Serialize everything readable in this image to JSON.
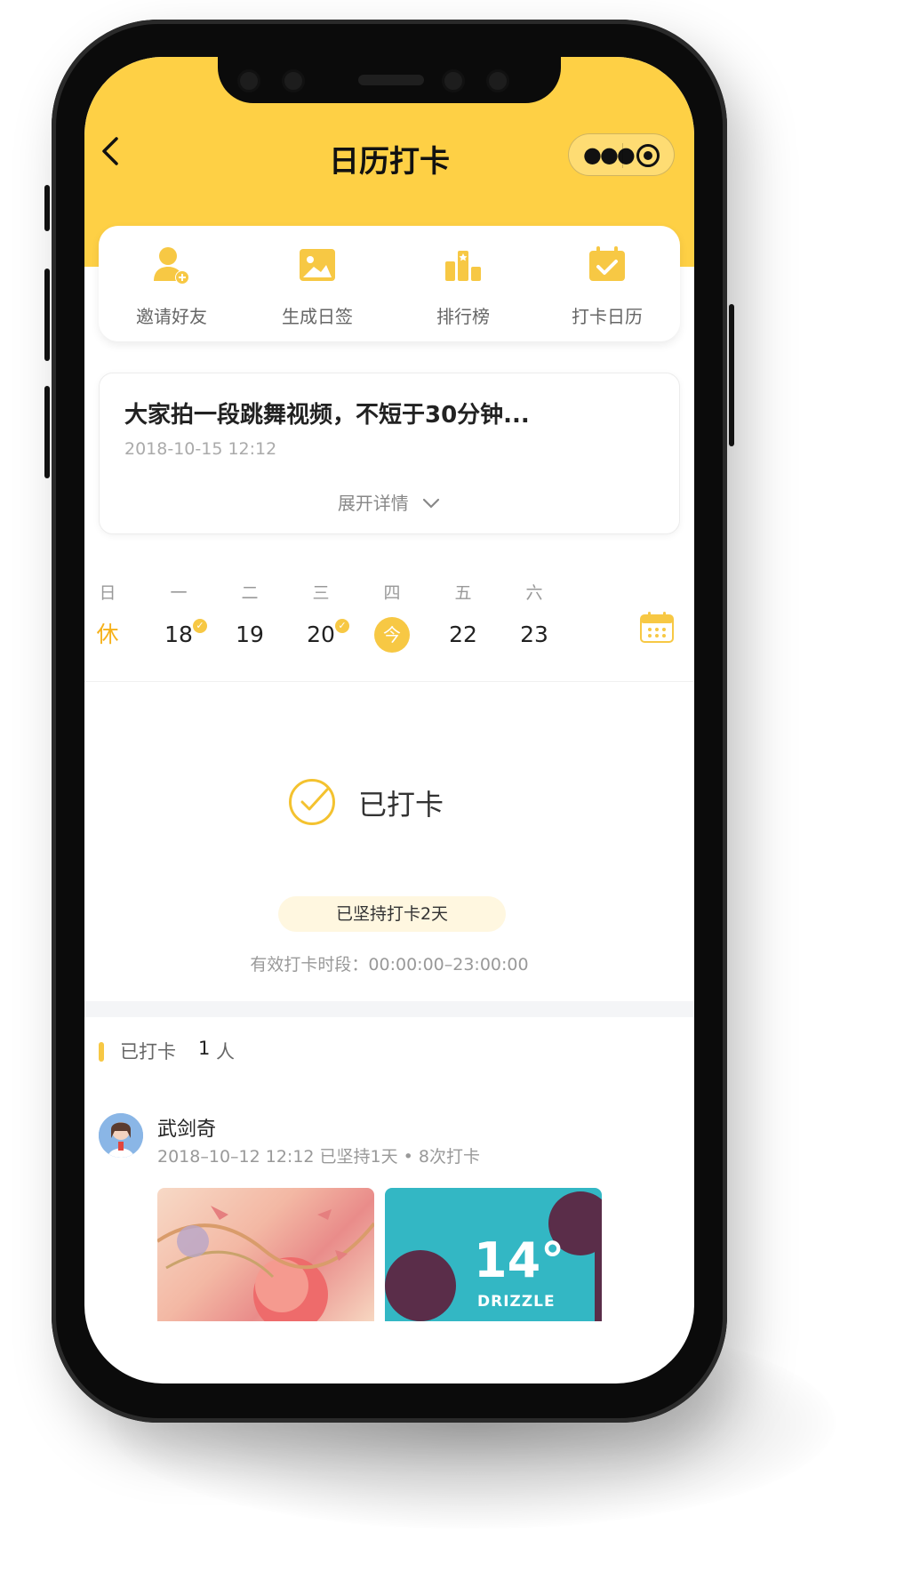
{
  "header": {
    "title": "日历打卡",
    "back_icon": "chevron-left-icon",
    "more_icon": "more-dots-icon",
    "close_icon": "record-circle-icon"
  },
  "quick_actions": [
    {
      "label": "邀请好友",
      "icon": "add-user-icon"
    },
    {
      "label": "生成日签",
      "icon": "image-icon"
    },
    {
      "label": "排行榜",
      "icon": "ranking-icon"
    },
    {
      "label": "打卡日历",
      "icon": "calendar-check-icon"
    }
  ],
  "topic": {
    "title": "大家拍一段跳舞视频，不短于30分钟...",
    "date": "2018-10-15 12:12",
    "expand_label": "展开详情"
  },
  "week": {
    "weekdays": [
      "日",
      "一",
      "二",
      "三",
      "四",
      "五",
      "六"
    ],
    "days": [
      {
        "label": "休",
        "state": "rest"
      },
      {
        "label": "18",
        "state": "checked"
      },
      {
        "label": "19",
        "state": "normal"
      },
      {
        "label": "20",
        "state": "checked"
      },
      {
        "label": "今",
        "state": "today"
      },
      {
        "label": "22",
        "state": "normal"
      },
      {
        "label": "23",
        "state": "normal"
      }
    ],
    "calendar_icon": "calendar-icon"
  },
  "checkin": {
    "status": "已打卡",
    "streak": "已坚持打卡2天",
    "period": "有效打卡时段：00:00:00–23:00:00"
  },
  "checked_section": {
    "label": "已打卡",
    "count": "1",
    "unit": "人"
  },
  "post": {
    "username": "武剑奇",
    "meta": "2018–10–12 12:12    已坚持1天 • 8次打卡",
    "weather_temp": "14°",
    "weather_text": "DRIZZLE"
  },
  "colors": {
    "accent": "#fed045",
    "accent_dark": "#f7c844",
    "rest": "#f6b11a"
  }
}
